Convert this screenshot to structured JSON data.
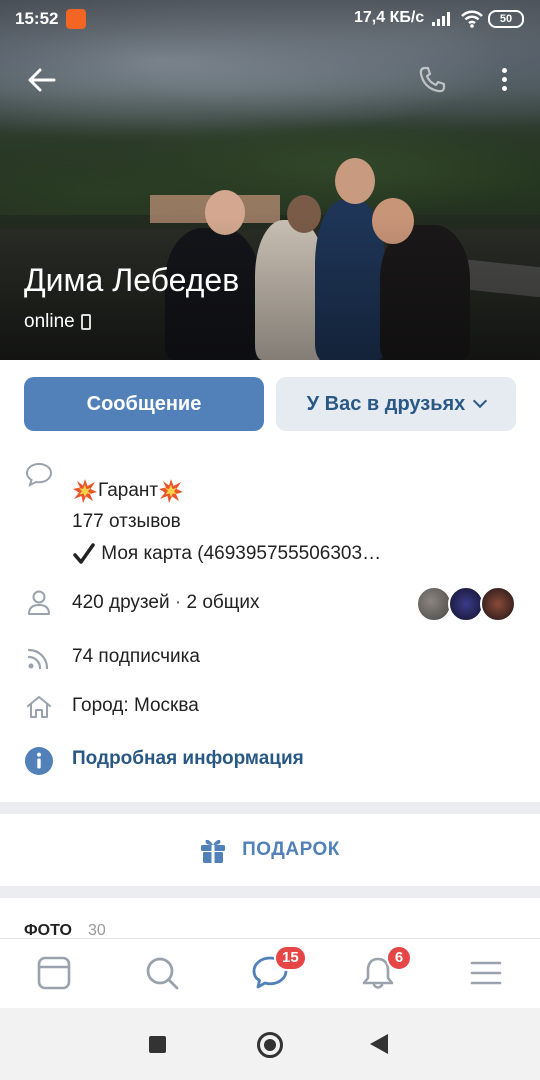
{
  "status_bar": {
    "time": "15:52",
    "network_speed": "17,4 КБ/с",
    "battery": "50"
  },
  "profile": {
    "name": "Дима Лебедев",
    "status": "online"
  },
  "actions": {
    "message_label": "Сообщение",
    "friends_label": "У Вас в друзьях"
  },
  "info": {
    "status_line1": "Гарант",
    "status_line2": "177 отзывов",
    "status_line3": "Моя карта (469395755506303…",
    "friends": "420 друзей",
    "mutual": "2 общих",
    "followers": "74 подписчика",
    "city": "Город: Москва",
    "details_link": "Подробная информация"
  },
  "gift": {
    "label": "ПОДАРОК"
  },
  "photos": {
    "title": "ФОТО",
    "count": "30"
  },
  "tabbar": {
    "messages_badge": "15",
    "notifications_badge": "6"
  },
  "colors": {
    "accent": "#5181b8",
    "link": "#2a5885",
    "badge": "#e64646"
  }
}
